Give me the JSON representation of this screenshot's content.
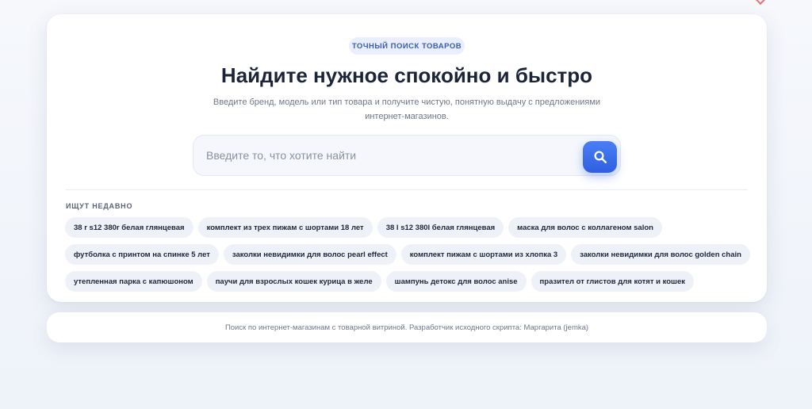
{
  "hero": {
    "badge": "ТОЧНЫЙ ПОИСК ТОВАРОВ",
    "title": "Найдите нужное спокойно и быстро",
    "subtitle": "Введите бренд, модель или тип товара и получите чистую, понятную выдачу с предложениями интернет-магазинов."
  },
  "search": {
    "value": "",
    "placeholder": "Введите то, что хотите найти",
    "button_icon": "search-icon",
    "accent": "#3a6ef0"
  },
  "recent": {
    "label": "ИЩУТ НЕДАВНО",
    "rows": [
      [
        "38 r s12 380r белая глянцевая",
        "комплект из трех пижам с шортами 18 лет",
        "38 l s12 380l белая глянцевая",
        "маска для волос с коллагеном salon"
      ],
      [
        "футболка с принтом на спинке 5 лет",
        "заколки невидимки для волос pearl effect",
        "комплект пижам с шортами из хлопка 3",
        "заколки невидимки для волос golden chain"
      ],
      [
        "утепленная парка с капюшоном",
        "паучи для взрослых кошек курица в желе",
        "шампунь детокс для волос anise",
        "празител от глистов для котят и кошек"
      ]
    ]
  },
  "footer": {
    "text": "Поиск по интернет-магазинам с товарной витриной. Разработчик исходного скрипта: Маргарита (jemka)"
  }
}
